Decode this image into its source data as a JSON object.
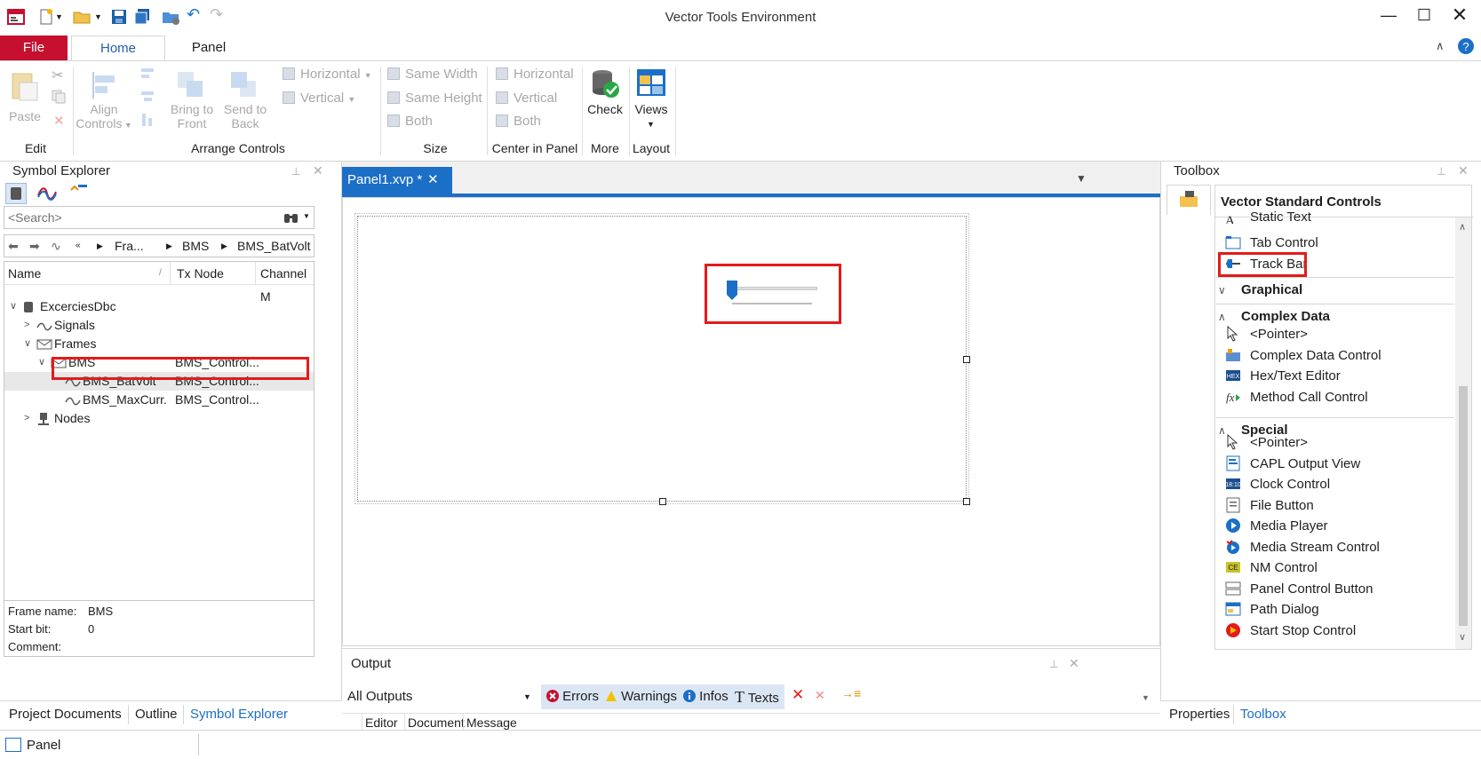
{
  "window": {
    "title": "Vector Tools Environment"
  },
  "ribbon_tabs": {
    "file": "File",
    "home": "Home",
    "panel": "Panel"
  },
  "ribbon": {
    "edit": {
      "paste": "Paste",
      "group": "Edit"
    },
    "arrange": {
      "align_line1": "Align",
      "align_line2": "Controls",
      "bring_line1": "Bring to",
      "bring_line2": "Front",
      "send_line1": "Send to",
      "send_line2": "Back",
      "horizontal": "Horizontal",
      "vertical": "Vertical",
      "group": "Arrange Controls"
    },
    "size": {
      "same_width": "Same Width",
      "same_height": "Same Height",
      "both": "Both",
      "group": "Size"
    },
    "center": {
      "horizontal": "Horizontal",
      "vertical": "Vertical",
      "both": "Both",
      "group": "Center in Panel"
    },
    "more": {
      "check": "Check",
      "group": "More"
    },
    "layout": {
      "views": "Views",
      "group": "Layout"
    }
  },
  "symbol_explorer": {
    "title": "Symbol Explorer",
    "search_placeholder": "<Search>",
    "breadcrumb": [
      "Fra...",
      "BMS",
      "BMS_BatVolt"
    ],
    "columns": [
      "Name",
      "Tx Node",
      "Channel M"
    ],
    "tree": [
      {
        "label": "ExcerciesDbc",
        "tx": "",
        "level": 0,
        "expander": "open",
        "icon": "database-icon"
      },
      {
        "label": "Signals",
        "tx": "",
        "level": 1,
        "expander": "closed",
        "icon": "signal-icon"
      },
      {
        "label": "Frames",
        "tx": "",
        "level": 1,
        "expander": "open",
        "icon": "envelope-icon"
      },
      {
        "label": "BMS",
        "tx": "BMS_Control...",
        "level": 2,
        "expander": "open",
        "icon": "envelope-icon"
      },
      {
        "label": "BMS_BatVolt",
        "tx": "BMS_Control...",
        "level": 3,
        "expander": "",
        "icon": "signal-icon"
      },
      {
        "label": "BMS_MaxCurr...",
        "tx": "BMS_Control...",
        "level": 3,
        "expander": "",
        "icon": "signal-icon"
      },
      {
        "label": "Nodes",
        "tx": "",
        "level": 1,
        "expander": "closed",
        "icon": "node-icon"
      }
    ],
    "details": [
      {
        "key": "Frame name:",
        "value": "BMS"
      },
      {
        "key": "Start bit:",
        "value": "0"
      },
      {
        "key": "Comment:",
        "value": ""
      }
    ],
    "bottom_tabs": [
      "Project Documents",
      "Outline",
      "Symbol Explorer"
    ]
  },
  "editor": {
    "doc_tab": "Panel1.xvp *"
  },
  "output": {
    "title": "Output",
    "filter": "All Outputs",
    "buttons": {
      "errors": "Errors",
      "warnings": "Warnings",
      "infos": "Infos",
      "texts": "Texts"
    },
    "columns": [
      "Editor",
      "Document",
      "Message"
    ]
  },
  "toolbox": {
    "title": "Toolbox",
    "section": "Vector Standard Controls",
    "std_items": [
      "Static Text",
      "Tab Control",
      "Track Bar"
    ],
    "graphical": "Graphical",
    "complex": {
      "title": "Complex Data",
      "items": [
        "<Pointer>",
        "Complex Data Control",
        "Hex/Text Editor",
        "Method Call Control"
      ]
    },
    "special": {
      "title": "Special",
      "items": [
        "<Pointer>",
        "CAPL Output View",
        "Clock Control",
        "File Button",
        "Media Player",
        "Media Stream Control",
        "NM Control",
        "Panel Control Button",
        "Path Dialog",
        "Start Stop Control"
      ]
    },
    "bottom_tabs": [
      "Properties",
      "Toolbox"
    ]
  },
  "status": {
    "panel": "Panel"
  },
  "colors": {
    "accent": "#1c6fc6",
    "file_tab": "#c5102f",
    "highlight": "#e21b1b"
  }
}
